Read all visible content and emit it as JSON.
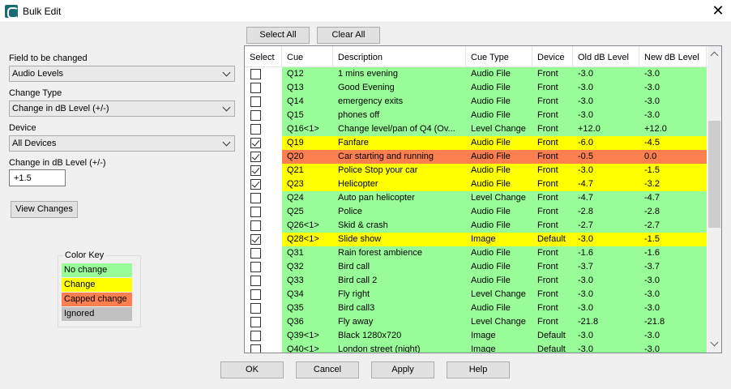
{
  "window": {
    "title": "Bulk Edit",
    "close": "✕"
  },
  "left": {
    "field_label": "Field to be changed",
    "field_value": "Audio Levels",
    "change_type_label": "Change Type",
    "change_type_value": "Change in dB Level (+/-)",
    "device_label": "Device",
    "device_value": "All Devices",
    "change_db_label": "Change in dB Level (+/-)",
    "change_db_value": "+1.5",
    "view_changes": "View Changes"
  },
  "color_key": {
    "title": "Color Key",
    "items": [
      {
        "label": "No change",
        "color": "#98fc98"
      },
      {
        "label": "Change",
        "color": "#ffff00"
      },
      {
        "label": "Capped change",
        "color": "#fc7f50"
      },
      {
        "label": "Ignored",
        "color": "#c0c0c0"
      }
    ]
  },
  "top_buttons": {
    "select_all": "Select All",
    "clear_all": "Clear All"
  },
  "columns": [
    "Select",
    "Cue",
    "Description",
    "Cue Type",
    "Device",
    "Old dB Level",
    "New dB Level"
  ],
  "rows": [
    {
      "checked": false,
      "cue": "Q12",
      "desc": "1 mins evening",
      "type": "Audio File",
      "device": "Front",
      "old": "-3.0",
      "new": "-3.0",
      "status": "none"
    },
    {
      "checked": false,
      "cue": "Q13",
      "desc": "Good Evening",
      "type": "Audio File",
      "device": "Front",
      "old": "-3.0",
      "new": "-3.0",
      "status": "none"
    },
    {
      "checked": false,
      "cue": "Q14",
      "desc": "emergency exits",
      "type": "Audio File",
      "device": "Front",
      "old": "-3.0",
      "new": "-3.0",
      "status": "none"
    },
    {
      "checked": false,
      "cue": "Q15",
      "desc": "phones off",
      "type": "Audio File",
      "device": "Front",
      "old": "-3.0",
      "new": "-3.0",
      "status": "none"
    },
    {
      "checked": false,
      "cue": "Q16<1>",
      "desc": "Change level/pan of Q4 (Ov...",
      "type": "Level Change",
      "device": "Front",
      "old": "+12.0",
      "new": "+12.0",
      "status": "none"
    },
    {
      "checked": true,
      "cue": "Q19",
      "desc": "Fanfare",
      "type": "Audio File",
      "device": "Front",
      "old": "-6.0",
      "new": "-4.5",
      "status": "change"
    },
    {
      "checked": true,
      "cue": "Q20",
      "desc": "Car starting and running",
      "type": "Audio File",
      "device": "Front",
      "old": "-0.5",
      "new": "0.0",
      "status": "capped"
    },
    {
      "checked": true,
      "cue": "Q21",
      "desc": "Police Stop your car",
      "type": "Audio File",
      "device": "Front",
      "old": "-3.0",
      "new": "-1.5",
      "status": "change"
    },
    {
      "checked": true,
      "cue": "Q23",
      "desc": "Helicopter",
      "type": "Audio File",
      "device": "Front",
      "old": "-4.7",
      "new": "-3.2",
      "status": "change"
    },
    {
      "checked": false,
      "cue": "Q24",
      "desc": "Auto pan helicopter",
      "type": "Level Change",
      "device": "Front",
      "old": "-4.7",
      "new": "-4.7",
      "status": "none"
    },
    {
      "checked": false,
      "cue": "Q25",
      "desc": "Police",
      "type": "Audio File",
      "device": "Front",
      "old": "-2.8",
      "new": "-2.8",
      "status": "none"
    },
    {
      "checked": false,
      "cue": "Q26<1>",
      "desc": "Skid & crash",
      "type": "Audio File",
      "device": "Front",
      "old": "-2.7",
      "new": "-2.7",
      "status": "none"
    },
    {
      "checked": true,
      "cue": "Q28<1>",
      "desc": "Slide show",
      "type": "Image",
      "device": "Default",
      "old": "-3.0",
      "new": "-1.5",
      "status": "change"
    },
    {
      "checked": false,
      "cue": "Q31",
      "desc": "Rain forest ambience",
      "type": "Audio File",
      "device": "Front",
      "old": "-1.6",
      "new": "-1.6",
      "status": "none"
    },
    {
      "checked": false,
      "cue": "Q32",
      "desc": "Bird call",
      "type": "Audio File",
      "device": "Front",
      "old": "-3.7",
      "new": "-3.7",
      "status": "none"
    },
    {
      "checked": false,
      "cue": "Q33",
      "desc": "Bird call 2",
      "type": "Audio File",
      "device": "Front",
      "old": "-3.0",
      "new": "-3.0",
      "status": "none"
    },
    {
      "checked": false,
      "cue": "Q34",
      "desc": "Fly right",
      "type": "Level Change",
      "device": "Front",
      "old": "-3.0",
      "new": "-3.0",
      "status": "none"
    },
    {
      "checked": false,
      "cue": "Q35",
      "desc": "Bird call3",
      "type": "Audio File",
      "device": "Front",
      "old": "-3.0",
      "new": "-3.0",
      "status": "none"
    },
    {
      "checked": false,
      "cue": "Q36",
      "desc": "Fly away",
      "type": "Level Change",
      "device": "Front",
      "old": "-21.8",
      "new": "-21.8",
      "status": "none"
    },
    {
      "checked": false,
      "cue": "Q39<1>",
      "desc": "Black 1280x720",
      "type": "Image",
      "device": "Default",
      "old": "-3.0",
      "new": "-3.0",
      "status": "none"
    },
    {
      "checked": false,
      "cue": "Q40<1>",
      "desc": "London street (night)",
      "type": "Image",
      "device": "Default",
      "old": "-3.0",
      "new": "-3.0",
      "status": "none"
    }
  ],
  "footer": {
    "ok": "OK",
    "cancel": "Cancel",
    "apply": "Apply",
    "help": "Help"
  }
}
